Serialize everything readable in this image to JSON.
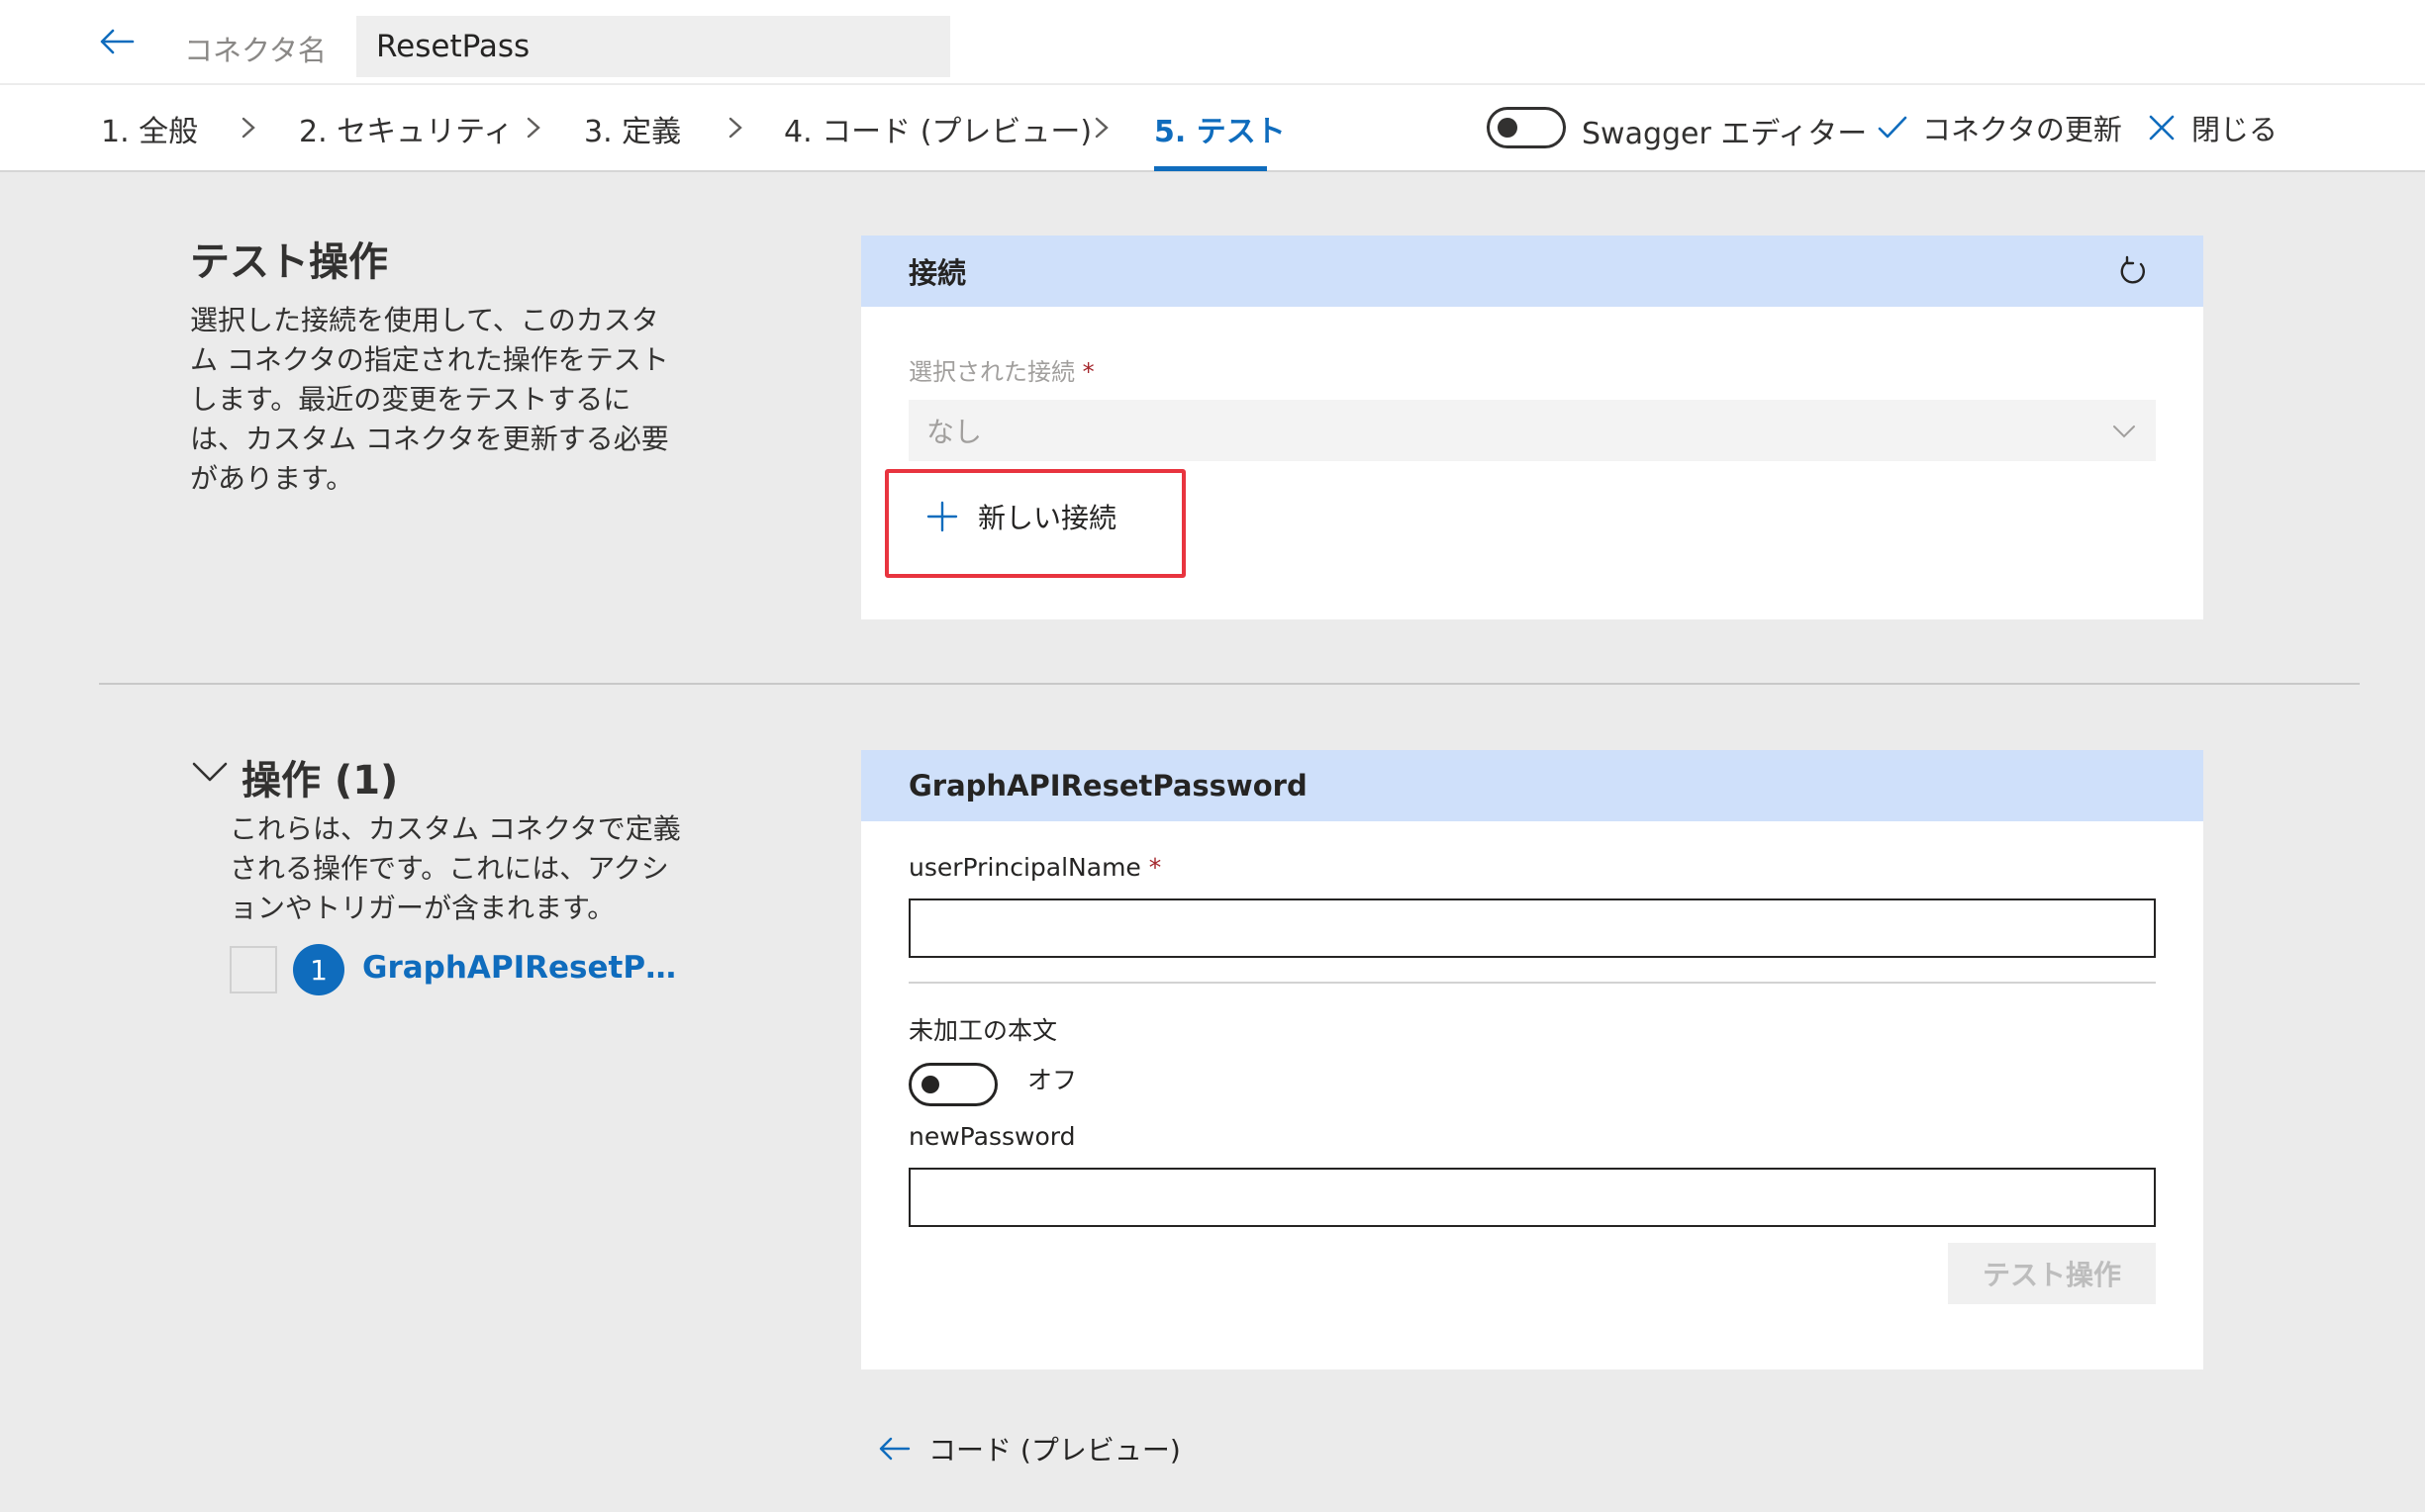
{
  "header": {
    "connector_name_label": "コネクタ名",
    "connector_name_value": "ResetPass"
  },
  "steps": [
    {
      "label": "1. 全般",
      "active": false
    },
    {
      "label": "2. セキュリティ",
      "active": false
    },
    {
      "label": "3. 定義",
      "active": false
    },
    {
      "label": "4. コード (プレビュー)",
      "active": false
    },
    {
      "label": "5. テスト",
      "active": true
    }
  ],
  "toolbar": {
    "swagger_label": "Swagger エディター",
    "swagger_on": false,
    "update_label": "コネクタの更新",
    "close_label": "閉じる"
  },
  "test_section": {
    "title": "テスト操作",
    "description": "選択した接続を使用して、このカスタム コネクタの指定された操作をテストします。最近の変更をテストするには、カスタム コネクタを更新する必要があります。"
  },
  "connection_card": {
    "title": "接続",
    "selected_label": "選択された接続",
    "required_mark": "*",
    "selected_value": "なし",
    "new_connection_label": "新しい接続"
  },
  "operations": {
    "title": "操作 (1)",
    "description": "これらは、カスタム コネクタで定義される操作です。これには、アクションやトリガーが含まれます。",
    "items": [
      {
        "number": "1",
        "name": "GraphAPIResetP…"
      }
    ]
  },
  "operation_card": {
    "title": "GraphAPIResetPassword",
    "field1_label": "userPrincipalName",
    "field1_required": "*",
    "field1_value": "",
    "raw_body_label": "未加工の本文",
    "raw_body_state": "オフ",
    "field2_label": "newPassword",
    "field2_value": "",
    "test_button_label": "テスト操作"
  },
  "footer": {
    "back_label": "コード (プレビュー)"
  },
  "colors": {
    "accent": "#0f6cbd",
    "card_header": "#cfe0fa",
    "highlight": "#e8343f",
    "required": "#a4262c"
  }
}
